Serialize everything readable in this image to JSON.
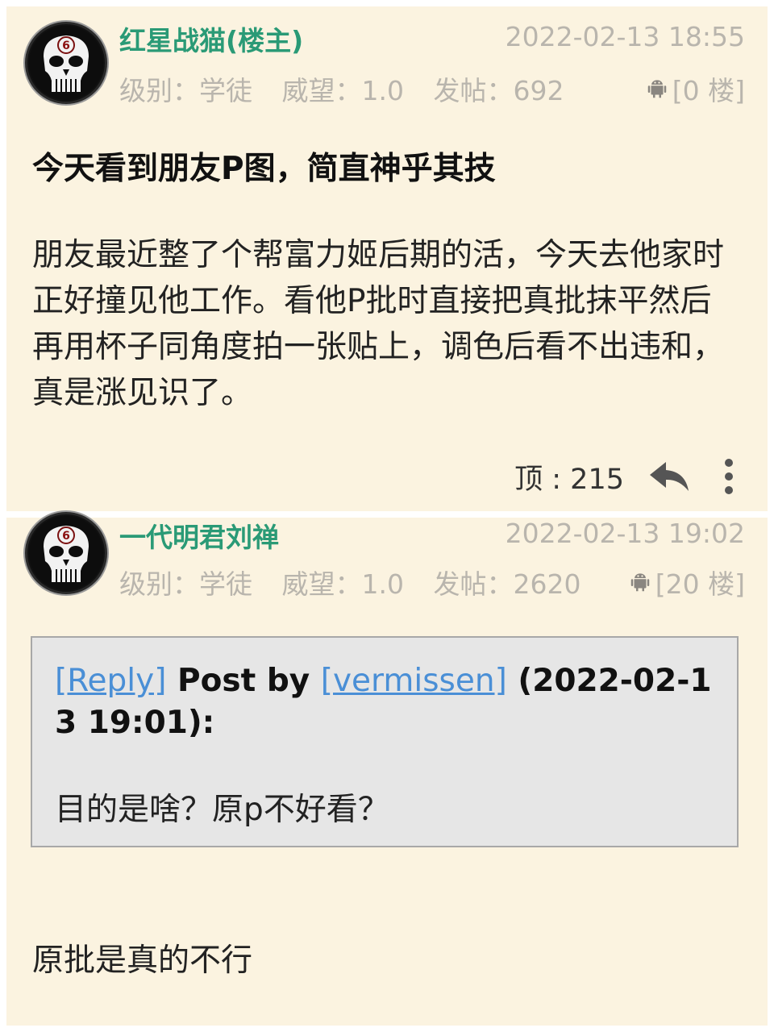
{
  "posts": [
    {
      "username": "红星战猫(楼主)",
      "timestamp": "2022-02-13 18:55",
      "level_label": "级别：学徒",
      "prestige_label": "威望：1.0",
      "post_count_label": "发帖：692",
      "floor": "[0 楼]",
      "device_icon": "android-icon",
      "avatar_badge": "6",
      "title": "今天看到朋友P图，简直神乎其技",
      "body": "朋友最近整了个帮富力姬后期的活，今天去他家时正好撞见他工作。看他P批时直接把真批抹平然后再用杯子同角度拍一张贴上，调色后看不出违和，真是涨见识了。",
      "likes": "顶 : 215"
    },
    {
      "username": "一代明君刘禅",
      "timestamp": "2022-02-13 19:02",
      "level_label": "级别：学徒",
      "prestige_label": "威望：1.0",
      "post_count_label": "发帖：2620",
      "floor": "[20 楼]",
      "device_icon": "android-icon",
      "avatar_badge": "6",
      "quote": {
        "reply_link": "[Reply]",
        "post_by": " Post by ",
        "author_link": "[vermissen]",
        "date": " (2022-02-13 19:01):",
        "text": "目的是啥？原p不好看？"
      },
      "reply": "原批是真的不行"
    }
  ],
  "colors": {
    "card_bg": "#fbf3e0",
    "username": "#2a9a76",
    "meta": "#b9b5ad",
    "link": "#4a8fd6",
    "quote_bg": "#e6e6e6"
  }
}
